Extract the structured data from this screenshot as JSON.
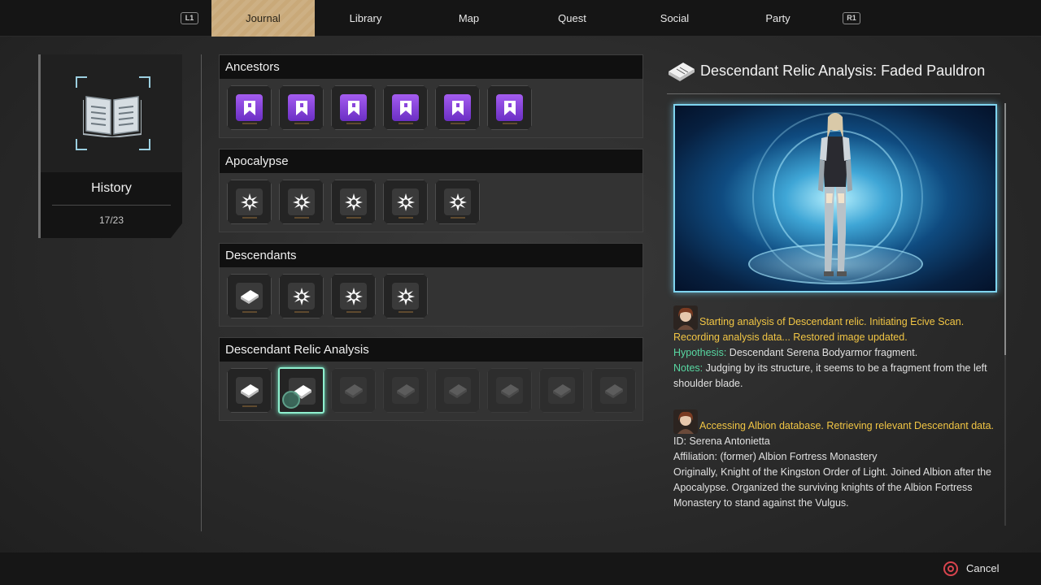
{
  "nav": {
    "left_hint": "L1",
    "right_hint": "R1",
    "tabs": [
      {
        "label": "Journal",
        "active": true
      },
      {
        "label": "Library",
        "active": false
      },
      {
        "label": "Map",
        "active": false
      },
      {
        "label": "Quest",
        "active": false
      },
      {
        "label": "Social",
        "active": false
      },
      {
        "label": "Party",
        "active": false
      }
    ]
  },
  "category": {
    "icon": "open-book-icon",
    "title": "History",
    "count": "17/23"
  },
  "sections": [
    {
      "title": "Ancestors",
      "items": [
        "bookmark-icon",
        "bookmark-icon",
        "bookmark-icon",
        "bookmark-icon",
        "bookmark-icon",
        "bookmark-icon"
      ]
    },
    {
      "title": "Apocalypse",
      "items": [
        "burst-icon",
        "burst-icon",
        "burst-icon",
        "burst-icon",
        "burst-icon"
      ]
    },
    {
      "title": "Descendants",
      "items": [
        "tablet-icon",
        "burst-icon",
        "burst-icon",
        "burst-icon"
      ]
    },
    {
      "title": "Descendant Relic Analysis",
      "items": [
        "tablet-icon",
        "tablet-icon",
        "tablet-icon",
        "tablet-icon",
        "tablet-icon",
        "tablet-icon",
        "tablet-icon",
        "tablet-icon"
      ],
      "unlocked": 2,
      "selected": 1
    }
  ],
  "detail": {
    "icon": "tablet-icon",
    "title": "Descendant Relic Analysis: Faded Pauldron",
    "log1": {
      "line1": "Starting analysis of Descendant relic. Initiating Ecive Scan.",
      "line2": "Recording analysis data... Restored image updated.",
      "hypothesis_label": "Hypothesis:",
      "hypothesis": "Descendant Serena Bodyarmor fragment.",
      "notes_label": "Notes:",
      "notes": "Judging by its structure, it seems to be a fragment from the left shoulder blade."
    },
    "log2": {
      "line1": "Accessing Albion database. Retrieving relevant Descendant data.",
      "id": "ID: Serena Antonietta",
      "affiliation": "Affiliation: (former) Albion Fortress Monastery",
      "body": "Originally, Knight of the Kingston Order of Light. Joined Albion after the Apocalypse. Organized the surviving knights of the Albion Fortress Monastery to stand against the Vulgus."
    }
  },
  "footer": {
    "cancel_icon": "circle-button-icon",
    "cancel_label": "Cancel"
  },
  "colors": {
    "accent_gold": "#c9a979",
    "highlight_text": "#f1c544",
    "label_green": "#58d7a2",
    "selection": "#8ff0cf",
    "hologram": "#7fd4ef"
  }
}
